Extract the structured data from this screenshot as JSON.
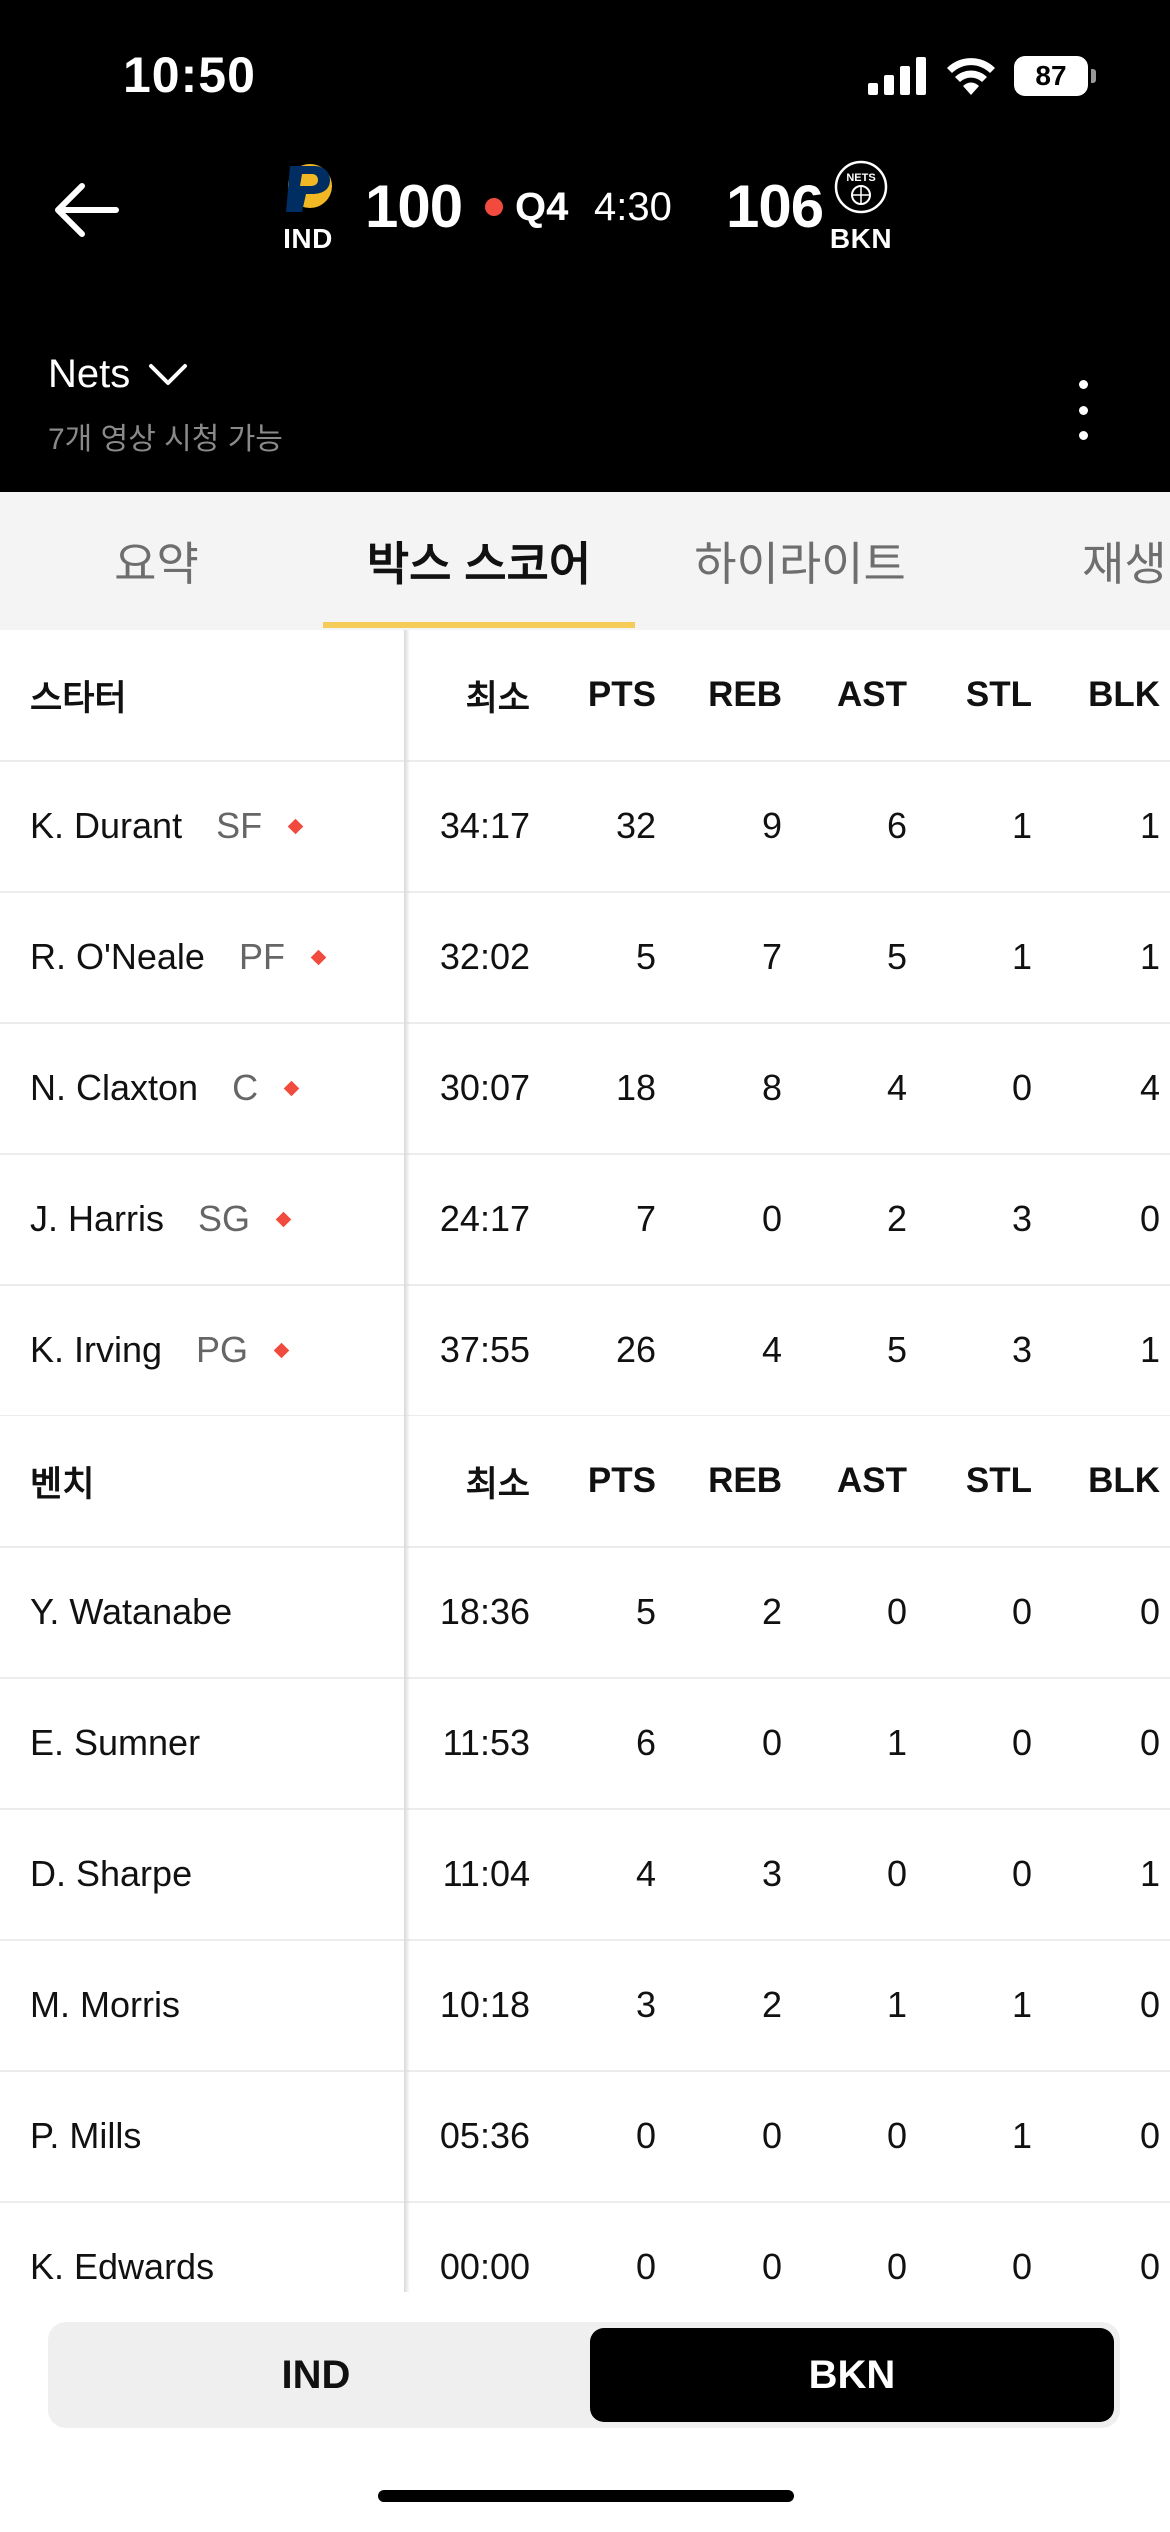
{
  "status_bar": {
    "time": "10:50",
    "battery": "87"
  },
  "game": {
    "away": {
      "abbr": "IND",
      "score": "100",
      "logo_icon": "pacers-logo-icon"
    },
    "home": {
      "abbr": "BKN",
      "score": "106",
      "logo_icon": "nets-logo-icon",
      "logo_text": "NETS"
    },
    "quarter": "Q4",
    "clock": "4:30",
    "live_color": "#f04b3e"
  },
  "channel": {
    "name": "Nets",
    "subtitle": "7개 영상 시청 가능"
  },
  "tabs": [
    {
      "label": "요약"
    },
    {
      "label": "박스 스코어"
    },
    {
      "label": "하이라이트"
    },
    {
      "label": "재생"
    }
  ],
  "accent_color": "#f5cc57",
  "starters": {
    "header": {
      "label": "스타터",
      "min": "최소",
      "pts": "PTS",
      "reb": "REB",
      "ast": "AST",
      "stl": "STL",
      "blk": "BLK"
    },
    "rows": [
      {
        "name": "K. Durant",
        "pos": "SF",
        "min": "34:17",
        "pts": "32",
        "reb": "9",
        "ast": "6",
        "stl": "1",
        "blk": "1"
      },
      {
        "name": "R. O'Neale",
        "pos": "PF",
        "min": "32:02",
        "pts": "5",
        "reb": "7",
        "ast": "5",
        "stl": "1",
        "blk": "1"
      },
      {
        "name": "N. Claxton",
        "pos": "C",
        "min": "30:07",
        "pts": "18",
        "reb": "8",
        "ast": "4",
        "stl": "0",
        "blk": "4"
      },
      {
        "name": "J. Harris",
        "pos": "SG",
        "min": "24:17",
        "pts": "7",
        "reb": "0",
        "ast": "2",
        "stl": "3",
        "blk": "0"
      },
      {
        "name": "K. Irving",
        "pos": "PG",
        "min": "37:55",
        "pts": "26",
        "reb": "4",
        "ast": "5",
        "stl": "3",
        "blk": "1"
      }
    ]
  },
  "bench": {
    "header": {
      "label": "벤치",
      "min": "최소",
      "pts": "PTS",
      "reb": "REB",
      "ast": "AST",
      "stl": "STL",
      "blk": "BLK"
    },
    "rows": [
      {
        "name": "Y. Watanabe",
        "min": "18:36",
        "pts": "5",
        "reb": "2",
        "ast": "0",
        "stl": "0",
        "blk": "0"
      },
      {
        "name": "E. Sumner",
        "min": "11:53",
        "pts": "6",
        "reb": "0",
        "ast": "1",
        "stl": "0",
        "blk": "0"
      },
      {
        "name": "D. Sharpe",
        "min": "11:04",
        "pts": "4",
        "reb": "3",
        "ast": "0",
        "stl": "0",
        "blk": "1"
      },
      {
        "name": "M. Morris",
        "min": "10:18",
        "pts": "3",
        "reb": "2",
        "ast": "1",
        "stl": "1",
        "blk": "0"
      },
      {
        "name": "P. Mills",
        "min": "05:36",
        "pts": "0",
        "reb": "0",
        "ast": "0",
        "stl": "1",
        "blk": "0"
      },
      {
        "name": "K. Edwards",
        "min": "00:00",
        "pts": "0",
        "reb": "0",
        "ast": "0",
        "stl": "0",
        "blk": "0"
      }
    ]
  },
  "team_toggle": {
    "left": "IND",
    "right": "BKN",
    "selected": "BKN"
  }
}
